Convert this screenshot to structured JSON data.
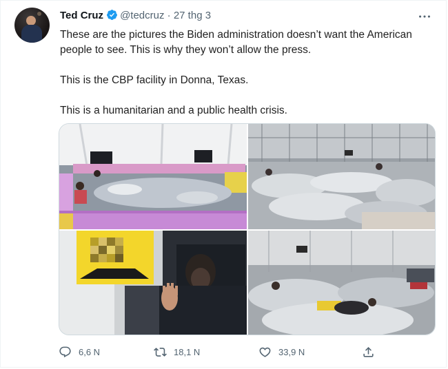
{
  "tweet": {
    "author_name": "Ted Cruz",
    "handle": "@tedcruz",
    "separator": "·",
    "date": "27 thg 3",
    "paragraphs": [
      "These are the pictures the Biden administration doesn’t want the American people to see. This is why they won’t allow the press.",
      "This is the CBP facility in Donna, Texas.",
      "This is a humanitarian and a public health crisis."
    ],
    "media": [
      {
        "alt": "photo-1"
      },
      {
        "alt": "photo-2"
      },
      {
        "alt": "photo-3"
      },
      {
        "alt": "photo-4"
      }
    ]
  },
  "actions": {
    "reply_count": "6,6 N",
    "retweet_count": "18,1 N",
    "like_count": "33,9 N"
  },
  "icons": {
    "verified": "verified-badge-icon",
    "more": "more-dots-icon",
    "reply": "reply-icon",
    "retweet": "retweet-icon",
    "like": "heart-icon",
    "share": "share-icon"
  },
  "colors": {
    "verified_blue": "#1d9bf0",
    "secondary_text": "#536471",
    "primary_text": "#0f1419"
  }
}
